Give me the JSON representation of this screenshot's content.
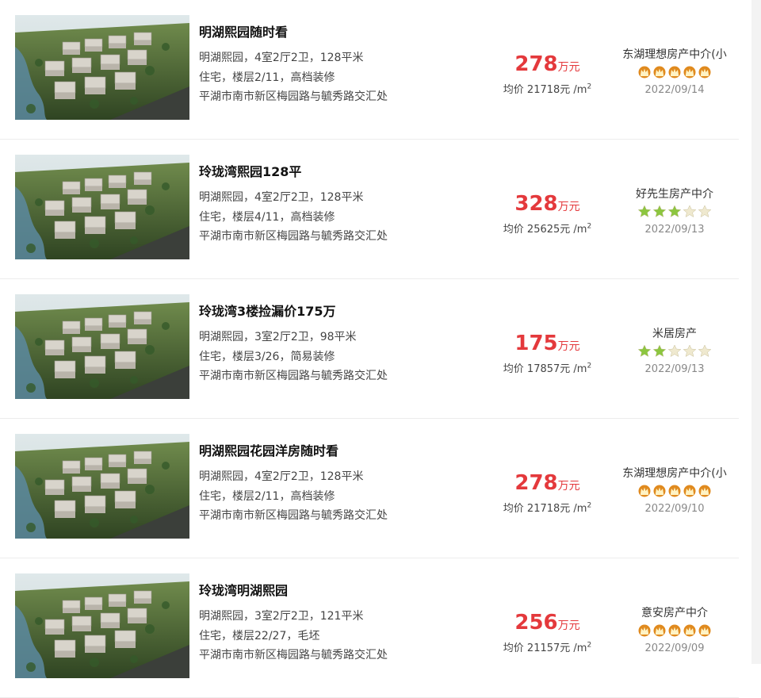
{
  "listings": [
    {
      "title": "明湖熙园随时看",
      "line1": "明湖熙园，4室2厅2卫，128平米",
      "line2": "住宅，楼层2/11，高档装修",
      "address": "平湖市南市新区梅园路与毓秀路交汇处",
      "price": "278",
      "price_unit": "万元",
      "avg": "均价 21718元 /m",
      "avg_sup": "2",
      "agency": "东湖理想房产中介(小",
      "rating": {
        "type": "crown",
        "count": 5,
        "max": 5
      },
      "date": "2022/09/14"
    },
    {
      "title": "玲珑湾熙园128平",
      "line1": "明湖熙园，4室2厅2卫，128平米",
      "line2": "住宅，楼层4/11，高档装修",
      "address": "平湖市南市新区梅园路与毓秀路交汇处",
      "price": "328",
      "price_unit": "万元",
      "avg": "均价 25625元 /m",
      "avg_sup": "2",
      "agency": "好先生房产中介",
      "rating": {
        "type": "star",
        "count": 3,
        "max": 5
      },
      "date": "2022/09/13"
    },
    {
      "title": "玲珑湾3楼捡漏价175万",
      "line1": "明湖熙园，3室2厅2卫，98平米",
      "line2": "住宅，楼层3/26，简易装修",
      "address": "平湖市南市新区梅园路与毓秀路交汇处",
      "price": "175",
      "price_unit": "万元",
      "avg": "均价 17857元 /m",
      "avg_sup": "2",
      "agency": "米居房产",
      "rating": {
        "type": "star",
        "count": 2,
        "max": 5
      },
      "date": "2022/09/13"
    },
    {
      "title": "明湖熙园花园洋房随时看",
      "line1": "明湖熙园，4室2厅2卫，128平米",
      "line2": "住宅，楼层2/11，高档装修",
      "address": "平湖市南市新区梅园路与毓秀路交汇处",
      "price": "278",
      "price_unit": "万元",
      "avg": "均价 21718元 /m",
      "avg_sup": "2",
      "agency": "东湖理想房产中介(小",
      "rating": {
        "type": "crown",
        "count": 5,
        "max": 5
      },
      "date": "2022/09/10"
    },
    {
      "title": "玲珑湾明湖熙园",
      "line1": "明湖熙园，3室2厅2卫，121平米",
      "line2": "住宅，楼层22/27，毛坯",
      "address": "平湖市南市新区梅园路与毓秀路交汇处",
      "price": "256",
      "price_unit": "万元",
      "avg": "均价 21157元 /m",
      "avg_sup": "2",
      "agency": "意安房产中介",
      "rating": {
        "type": "crown",
        "count": 5,
        "max": 5
      },
      "date": "2022/09/09"
    }
  ],
  "colors": {
    "price": "#e4393c",
    "crown": "#e08a1e",
    "star_on": "#8cc63f",
    "star_off": "#efe9cf"
  },
  "icons": {
    "photo": "building-render-photo",
    "crown": "crown-icon",
    "star": "star-icon"
  }
}
